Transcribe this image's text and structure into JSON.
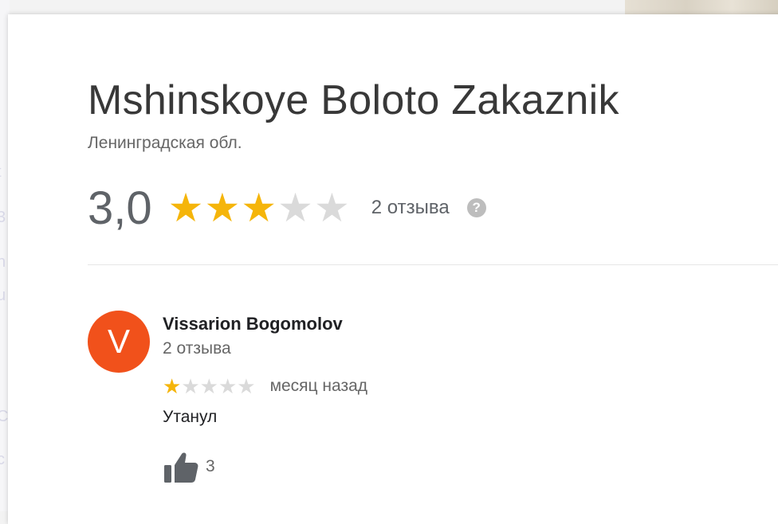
{
  "place": {
    "name": "Mshinskoye Boloto Zakaznik",
    "region": "Ленинградская обл."
  },
  "rating": {
    "value": "3,0",
    "stars_filled": 3,
    "stars_total": 5,
    "reviews_label": "2 отзыва",
    "help_icon": "?"
  },
  "review": {
    "avatar_letter": "V",
    "author": "Vissarion Bogomolov",
    "author_reviews": "2 отзыва",
    "stars_filled": 1,
    "stars_total": 5,
    "date": "месяц назад",
    "text": "Утанул",
    "likes": "3"
  },
  "colors": {
    "star_filled": "#f5b50a",
    "star_empty": "#dadada",
    "avatar_bg": "#f1511b",
    "thumb": "#5f6368"
  },
  "background": {
    "sidebar_fragments": [
      "t",
      "3",
      "n",
      "u",
      "C",
      "c"
    ]
  }
}
